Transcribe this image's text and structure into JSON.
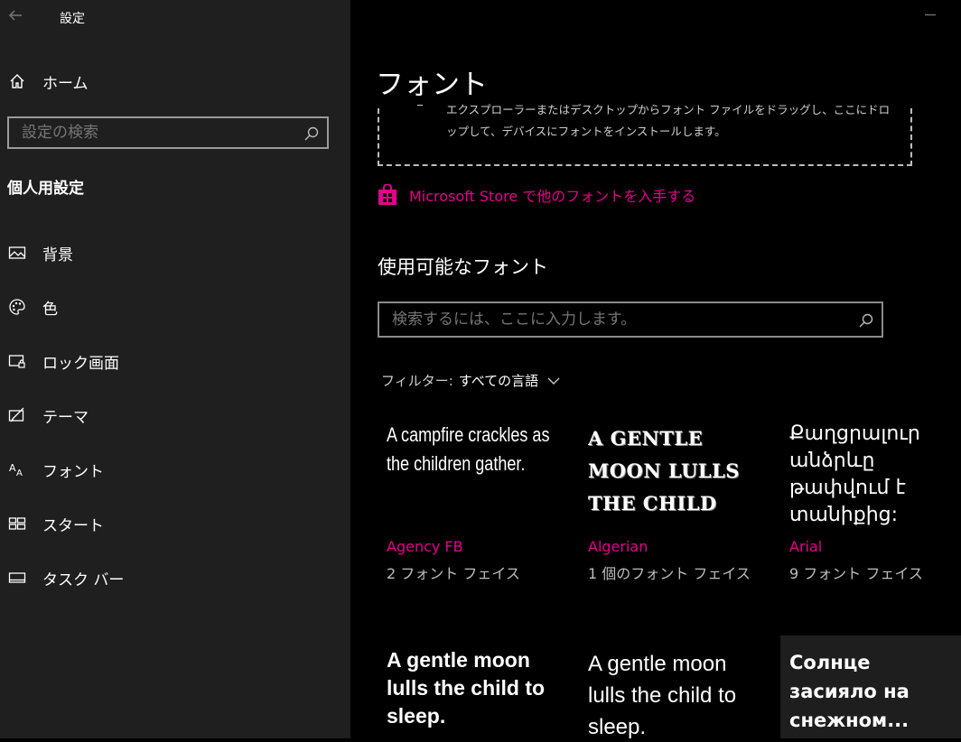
{
  "app": {
    "title": "設定"
  },
  "sidebar": {
    "home_label": "ホーム",
    "search_placeholder": "設定の検索",
    "section_title": "個人用設定",
    "items": [
      {
        "label": "背景",
        "icon": "image-icon"
      },
      {
        "label": "色",
        "icon": "palette-icon"
      },
      {
        "label": "ロック画面",
        "icon": "lock-screen-icon"
      },
      {
        "label": "テーマ",
        "icon": "theme-icon"
      },
      {
        "label": "フォント",
        "icon": "font-icon"
      },
      {
        "label": "スタート",
        "icon": "start-icon"
      },
      {
        "label": "タスク バー",
        "icon": "taskbar-icon"
      }
    ]
  },
  "main": {
    "title": "フォント",
    "drop_text": "エクスプローラーまたはデスクトップからフォント ファイルをドラッグし、ここにドロップして、デバイスにフォントをインストールします。",
    "store_link": "Microsoft Store で他のフォントを入手する",
    "available_title": "使用可能なフォント",
    "font_search_placeholder": "検索するには、ここに入力します。",
    "filter_label": "フィルター:",
    "filter_value": "すべての言語",
    "fonts": [
      {
        "sample": "A campfire crackles as the children gather.",
        "name": "Agency FB",
        "faces": "2 フォント フェイス"
      },
      {
        "sample": "A GENTLE MOON LULLS THE CHILD TO...",
        "name": "Algerian",
        "faces": "1 個のフォント フェイス"
      },
      {
        "sample": "Քաղցրալուր անձրևը թափվում է տանիքից:",
        "name": "Arial",
        "faces": "9 フォント フェイス"
      },
      {
        "sample": "A gentle moon lulls the child to sleep.",
        "name": "",
        "faces": ""
      },
      {
        "sample": "A gentle moon lulls the child to sleep.",
        "name": "",
        "faces": ""
      },
      {
        "sample": "Солнце засияло на снежном...",
        "name": "",
        "faces": ""
      }
    ]
  },
  "colors": {
    "accent": "#e3008c",
    "sidebar_bg": "#1f1f1f",
    "main_bg": "#000000"
  }
}
